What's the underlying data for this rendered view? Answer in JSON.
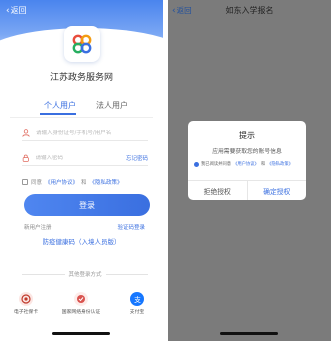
{
  "left": {
    "back_label": "返回",
    "app_title": "江苏政务服务网",
    "tabs": [
      {
        "label": "个人用户",
        "active": true
      },
      {
        "label": "法人用户",
        "active": false
      }
    ],
    "username_placeholder": "请输入身份证号/手机号/用户名",
    "password_placeholder": "请输入密码",
    "forgot_label": "忘记密码",
    "agree": {
      "prefix": "同意",
      "user_agreement": "《用户协议》",
      "and": "和",
      "privacy_policy": "《隐私政策》"
    },
    "login_label": "登录",
    "register_label": "新用户注册",
    "quick_login_label": "验证码登录",
    "fast_register_label": "防疫健康码（入境人员版）",
    "other_login_label": "其他登录方式",
    "options": [
      {
        "label": "电子社保卡",
        "icon": "social-security-card-icon",
        "color": "#c0392b"
      },
      {
        "label": "国家网络身份认证",
        "icon": "national-id-auth-icon",
        "color": "#d9534f"
      },
      {
        "label": "支付宝",
        "icon": "alipay-icon",
        "color": "#1677ff"
      }
    ],
    "colors": {
      "accent": "#3a6fe0",
      "header_gradient_top": "#4a84ee"
    }
  },
  "right": {
    "back_label": "返回",
    "nav_title": "如东入学报名",
    "dialog": {
      "title": "提示",
      "message": "应用需要获取您的账号信息",
      "agree_prefix": "我已阅读并同意",
      "user_agreement": "《用户协议》",
      "and": "和",
      "privacy_policy": "《隐私政策》",
      "reject_label": "拒绝授权",
      "confirm_label": "确定授权"
    },
    "colors": {
      "overlay": "#7b7b7b",
      "accent": "#3a6fe0"
    }
  }
}
